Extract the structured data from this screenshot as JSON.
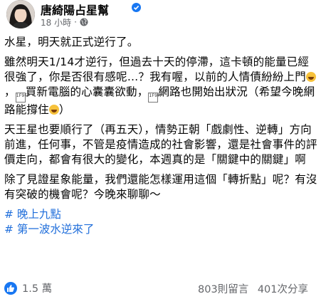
{
  "post": {
    "author": "唐綺陽占星幫",
    "time": "18 小時",
    "visibility_icon": "globe-icon",
    "verified_icon": "verified-badge-icon",
    "paragraphs": [
      "水星，明天就正式逆行了。",
      "雖然明天1/14才逆行，但過去十天的停滯，這卡頓的能量已經很強了，你是否很有感呢…？我有喔，以前的人情債紛紛上門",
      "買新電腦的心囊囊欲動，",
      "網路也開始出狀況（希望今晚網路能撐住",
      "天王星也要順行了（再五天），情勢正朝「戲劇性、逆轉」方向前進，任何事，不管是疫情造成的社會影響，還是社會事件的評價走向，都會有很大的變化，本週真的是「關鍵中的關鍵」啊",
      "除了見證星象能量，我們還能怎樣運用這個「轉折點」呢？有沒有突破的機會呢？今晚來聊聊～"
    ],
    "hashtags": [
      "# 晚上九點",
      "# 第一波水逆來了"
    ],
    "emoji_box_text": "1F9FF",
    "close_paren": "）"
  },
  "footer": {
    "reactions": "1.5 萬",
    "comments": "803則留言",
    "shares": "401次分享"
  },
  "colors": {
    "accent": "#1877f2",
    "hashtag": "#216fdb",
    "meta": "#65676b"
  }
}
